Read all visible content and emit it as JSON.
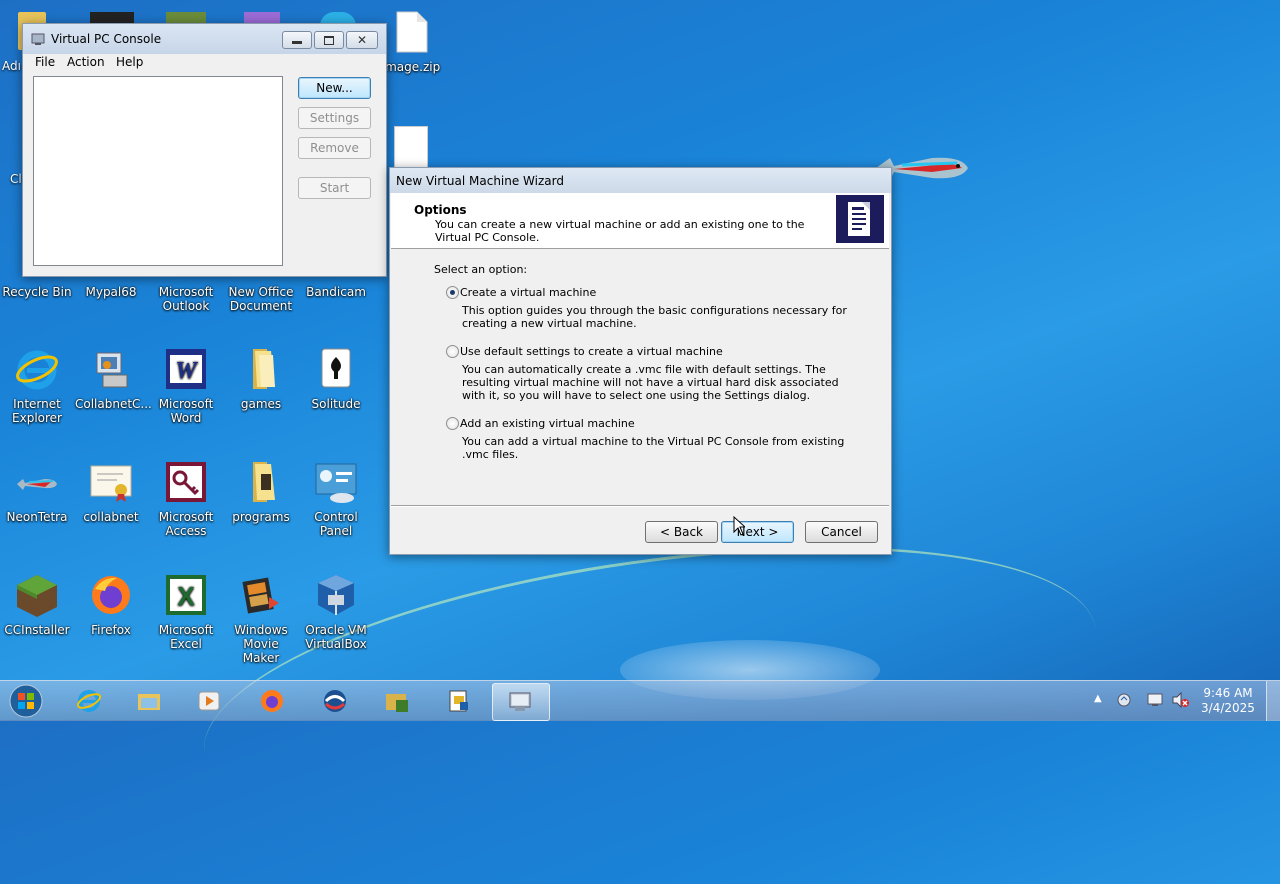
{
  "desktop": {
    "icons": [
      {
        "label": "Recycle Bin",
        "icon": "recycle-bin-icon"
      },
      {
        "label": "Mypal68",
        "icon": "mypal-browser-icon"
      },
      {
        "label": "Microsoft Outlook",
        "icon": "outlook-icon"
      },
      {
        "label": "New Office Document",
        "icon": "office-document-icon"
      },
      {
        "label": "Bandicam",
        "icon": "bandicam-icon"
      },
      {
        "label": "Internet Explorer",
        "icon": "internet-explorer-icon"
      },
      {
        "label": "CollabnetC...",
        "icon": "collabnet-client-icon"
      },
      {
        "label": "Microsoft Word",
        "icon": "word-icon"
      },
      {
        "label": "games",
        "icon": "folder-icon"
      },
      {
        "label": "Solitude",
        "icon": "solitaire-icon"
      },
      {
        "label": "NeonTetra",
        "icon": "fish-icon"
      },
      {
        "label": "collabnet",
        "icon": "certificate-icon"
      },
      {
        "label": "Microsoft Access",
        "icon": "access-icon"
      },
      {
        "label": "programs",
        "icon": "folder-icon"
      },
      {
        "label": "Control Panel",
        "icon": "control-panel-icon"
      },
      {
        "label": "CCInstaller",
        "icon": "minecraft-block-icon"
      },
      {
        "label": "Firefox",
        "icon": "firefox-icon"
      },
      {
        "label": "Microsoft Excel",
        "icon": "excel-icon"
      },
      {
        "label": "Windows Movie Maker",
        "icon": "movie-maker-icon"
      },
      {
        "label": "Oracle VM VirtualBox",
        "icon": "virtualbox-icon"
      },
      {
        "label": "image.zip",
        "icon": "file-icon"
      }
    ],
    "partial_labels": [
      "Adı",
      "Cl"
    ]
  },
  "console": {
    "title": "Virtual PC Console",
    "menu": [
      "File",
      "Action",
      "Help"
    ],
    "buttons": {
      "new": "New...",
      "settings": "Settings",
      "remove": "Remove",
      "start": "Start"
    }
  },
  "wizard": {
    "title": "New Virtual Machine Wizard",
    "header_title": "Options",
    "header_desc": "You can create a new virtual machine or add an existing one to the Virtual PC Console.",
    "prompt": "Select an option:",
    "options": [
      {
        "label": "Create a virtual machine",
        "selected": true,
        "desc": "This option guides you through the basic configurations necessary for creating a new virtual machine."
      },
      {
        "label": "Use default settings to create a virtual machine",
        "selected": false,
        "desc": "You can automatically create a .vmc file with default settings. The resulting virtual machine will not have a virtual hard disk associated with it, so you will have to select one using the Settings dialog."
      },
      {
        "label": "Add an existing virtual machine",
        "selected": false,
        "desc": "You can add a virtual machine to the Virtual PC Console from existing .vmc files."
      }
    ],
    "buttons": {
      "back": "< Back",
      "next": "Next >",
      "cancel": "Cancel"
    }
  },
  "taskbar": {
    "items": [
      "start-orb-icon",
      "internet-explorer-icon",
      "file-explorer-icon",
      "media-player-icon",
      "firefox-icon",
      "app-icon",
      "folder-app-icon",
      "notepad-app-icon",
      "virtual-pc-icon"
    ],
    "time": "9:46 AM",
    "date": "3/4/2025"
  },
  "colors": {
    "desktop": "#1a84d8",
    "dialog": "#f0f0f0",
    "header_icon_bg": "#1c1c5c"
  }
}
